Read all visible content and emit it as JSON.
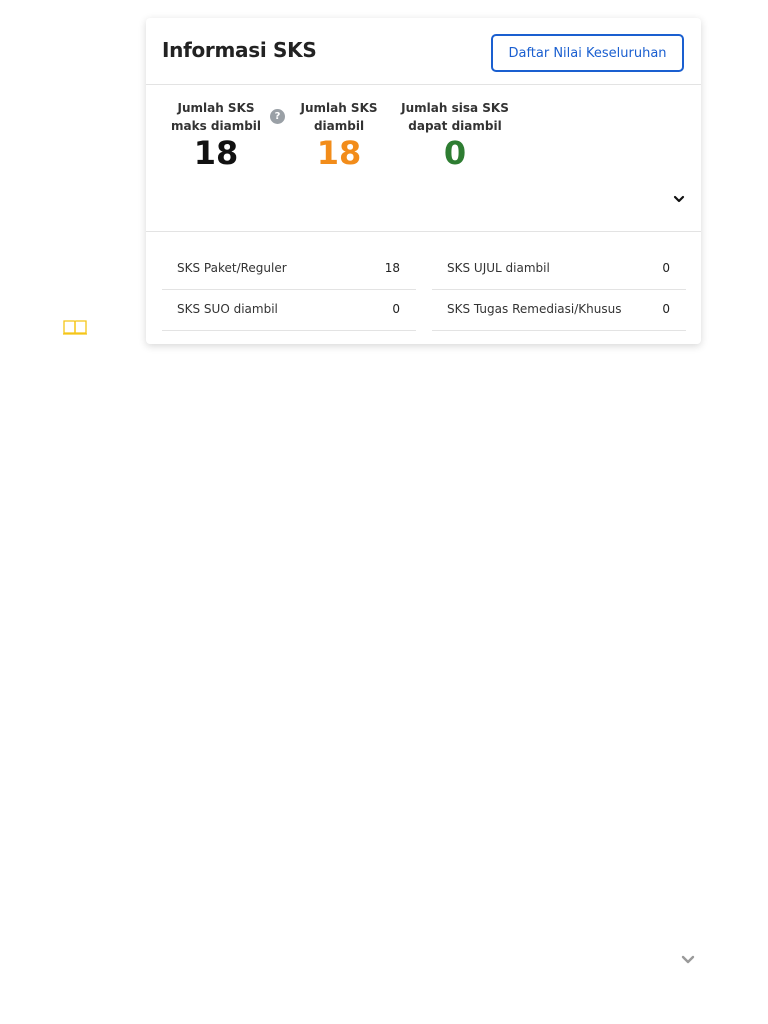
{
  "sidebar": {
    "icon": "book-icon",
    "accent": "#f5c518"
  },
  "card": {
    "title": "Informasi SKS",
    "header_button": "Daftar Nilai Keseluruhan"
  },
  "stats": [
    {
      "label_line1": "Jumlah SKS",
      "label_line2": "maks diambil",
      "value": "18",
      "color": "#111111"
    },
    {
      "label_line1": "Jumlah SKS",
      "label_line2": "diambil",
      "value": "18",
      "color": "#f28c1a"
    },
    {
      "label_line1": "Jumlah sisa SKS",
      "label_line2": "dapat diambil",
      "value": "0",
      "color": "#2e7d32"
    }
  ],
  "help_icon": "?",
  "details": {
    "left": [
      {
        "label": "SKS Paket/Reguler",
        "value": "18"
      },
      {
        "label": "SKS SUO diambil",
        "value": "0"
      }
    ],
    "right": [
      {
        "label": "SKS UJUL diambil",
        "value": "0"
      },
      {
        "label": "SKS Tugas Remediasi/Khusus",
        "value": "0"
      }
    ]
  },
  "colors": {
    "primary": "#1a5fd0",
    "border": "#e3e3e3"
  }
}
